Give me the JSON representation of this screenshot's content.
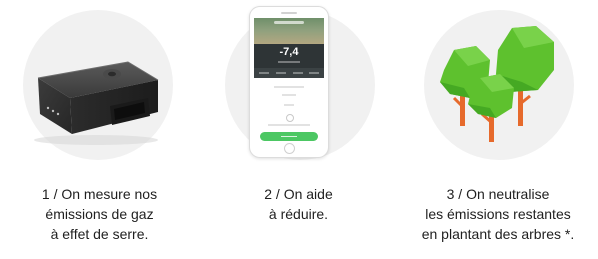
{
  "steps": [
    {
      "id": "measure",
      "illustration": "obd-tracker-device",
      "caption_lines": [
        "1 / On mesure nos",
        "émissions de gaz",
        "à effet de serre."
      ]
    },
    {
      "id": "reduce",
      "illustration": "smartphone-app",
      "app_value": "-7,4",
      "caption_lines": [
        "2 / On aide",
        "à réduire."
      ]
    },
    {
      "id": "offset",
      "illustration": "trees",
      "caption_lines": [
        "3 / On neutralise",
        "les émissions restantes",
        "en plantant des arbres *."
      ]
    }
  ],
  "colors": {
    "circle": "#f1f1f1",
    "tree_green": "#5ec12e",
    "tree_green_dark": "#3f9a1f",
    "trunk": "#e66a2c",
    "app_button": "#4cc763",
    "device": "#2f2f2f",
    "caption": "#1f1f1f"
  }
}
